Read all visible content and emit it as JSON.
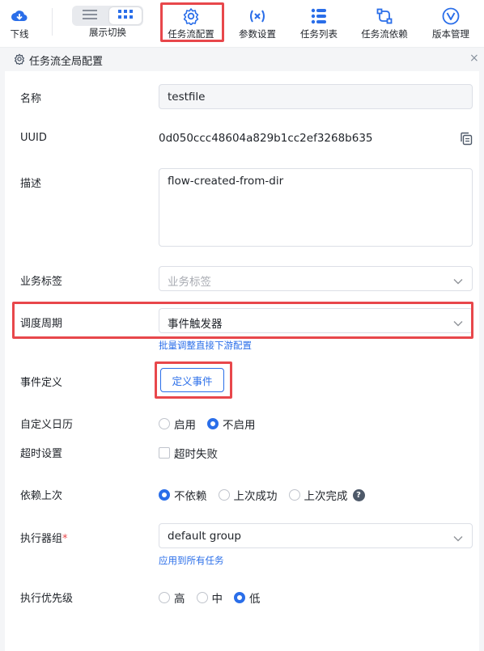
{
  "toolbar": {
    "download": "下线",
    "view_switch": "展示切换",
    "flow_config": "任务流配置",
    "param_settings": "参数设置",
    "task_list": "任务列表",
    "flow_deps": "任务流依赖",
    "version_mgmt": "版本管理"
  },
  "colors": {
    "accent": "#2a6ee9",
    "highlight": "#e8474b"
  },
  "icons": [
    "download-icon",
    "list-view-icon",
    "grid-view-icon",
    "gear-icon",
    "variable-icon",
    "list-icon",
    "dependency-icon",
    "version-icon",
    "copy-icon",
    "chevron-down-icon",
    "close-icon",
    "help-icon"
  ],
  "panel": {
    "title": "任务流全局配置",
    "close": "×"
  },
  "form": {
    "name": {
      "label": "名称",
      "value": "testfile"
    },
    "uuid": {
      "label": "UUID",
      "value": "0d050ccc48604a829b1cc2ef3268b635"
    },
    "description": {
      "label": "描述",
      "value": "flow-created-from-dir"
    },
    "tags": {
      "label": "业务标签",
      "placeholder": "业务标签"
    },
    "schedule": {
      "label": "调度周期",
      "value": "事件触发器",
      "link": "批量调整直接下游配置"
    },
    "event": {
      "label": "事件定义",
      "button": "定义事件"
    },
    "calendar": {
      "label": "自定义日历",
      "options": [
        "启用",
        "不启用"
      ],
      "selected": "不启用"
    },
    "timeout": {
      "label": "超时设置",
      "checkbox": "超时失败",
      "checked": false
    },
    "depend_last": {
      "label": "依赖上次",
      "options": [
        "不依赖",
        "上次成功",
        "上次完成"
      ],
      "selected": "不依赖"
    },
    "executor": {
      "label": "执行器组",
      "required": "*",
      "value": "default group",
      "link": "应用到所有任务"
    },
    "priority": {
      "label": "执行优先级",
      "options": [
        "高",
        "中",
        "低"
      ],
      "selected": "低"
    }
  }
}
